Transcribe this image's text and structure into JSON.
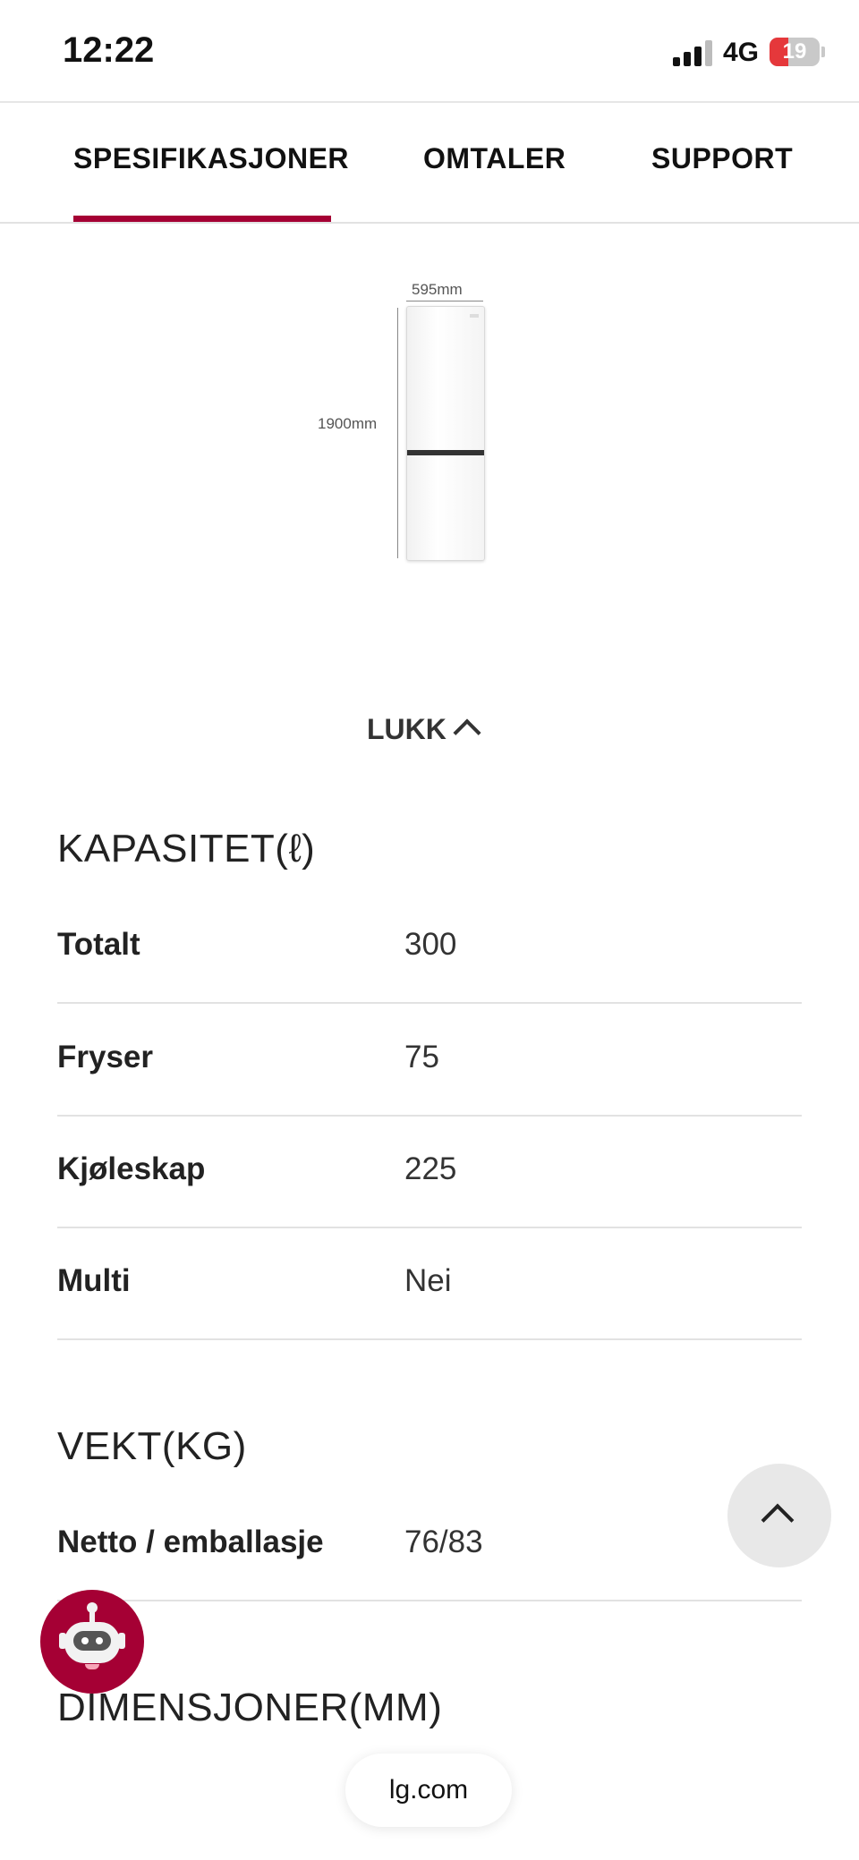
{
  "status_bar": {
    "time": "12:22",
    "network": "4G",
    "battery": "19"
  },
  "tabs": [
    {
      "label": "SPESIFIKASJONER",
      "active": true
    },
    {
      "label": "OMTALER",
      "active": false
    },
    {
      "label": "SUPPORT",
      "active": false
    }
  ],
  "product_image": {
    "width_label": "595mm",
    "height_label": "1900mm"
  },
  "close_toggle": {
    "label": "LUKK",
    "icon": "chevron-up-icon"
  },
  "sections": {
    "kapasitet": {
      "title": "KAPASITET(ℓ)",
      "rows": [
        {
          "label": "Totalt",
          "value": "300"
        },
        {
          "label": "Fryser",
          "value": "75"
        },
        {
          "label": "Kjøleskap",
          "value": "225"
        },
        {
          "label": "Multi",
          "value": "Nei"
        }
      ]
    },
    "vekt": {
      "title": "VEKT(KG)",
      "rows": [
        {
          "label": "Netto / emballasje",
          "value": "76/83"
        }
      ]
    },
    "dimensjoner": {
      "title": "DIMENSJONER(MM)"
    }
  },
  "floating": {
    "scroll_top_icon": "chevron-up-icon",
    "chatbot_icon": "robot-icon",
    "url": "lg.com"
  },
  "colors": {
    "accent": "#a50034",
    "divider": "#e2e2e2",
    "battery_low": "#e5383b"
  }
}
